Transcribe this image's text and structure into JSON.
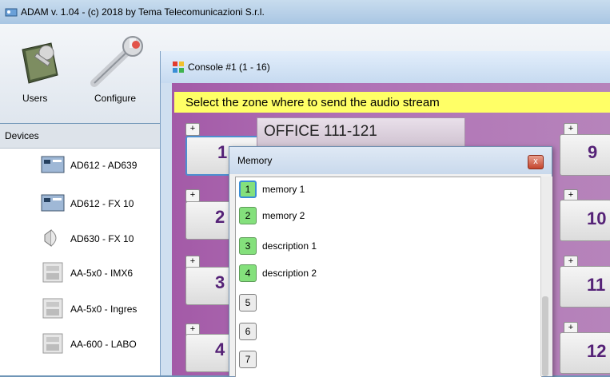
{
  "window": {
    "title": "ADAM v. 1.04 - (c) 2018 by Tema Telecomunicazioni S.r.l."
  },
  "toolbar": {
    "users_label": "Users",
    "configure_label": "Configure"
  },
  "devices": {
    "header": "Devices",
    "items": [
      {
        "label": "AD612 - AD639",
        "icon": "device-panel-icon"
      },
      {
        "label": "AD612 - FX 10",
        "icon": "device-panel-icon"
      },
      {
        "label": "AD630 - FX 10",
        "icon": "speaker-icon"
      },
      {
        "label": "AA-5x0 - IMX6",
        "icon": "intercom-icon"
      },
      {
        "label": "AA-5x0 - Ingres",
        "icon": "intercom-icon"
      },
      {
        "label": "AA-600 - LABO",
        "icon": "intercom-icon"
      }
    ]
  },
  "console": {
    "title": "Console #1 (1 - 16)",
    "prompt": "Select the zone where to send the audio stream",
    "zone_name": "OFFICE 111-121",
    "plus_label": "+",
    "zones_left": [
      "1",
      "2",
      "3",
      "4"
    ],
    "zones_right": [
      "9",
      "10",
      "11",
      "12"
    ]
  },
  "memory": {
    "title": "Memory",
    "close_label": "x",
    "items": [
      {
        "num": "1",
        "label": "memory 1"
      },
      {
        "num": "2",
        "label": "memory 2"
      },
      {
        "num": "3",
        "label": "description 1"
      },
      {
        "num": "4",
        "label": "description 2"
      },
      {
        "num": "5",
        "label": ""
      },
      {
        "num": "6",
        "label": ""
      },
      {
        "num": "7",
        "label": ""
      }
    ]
  }
}
